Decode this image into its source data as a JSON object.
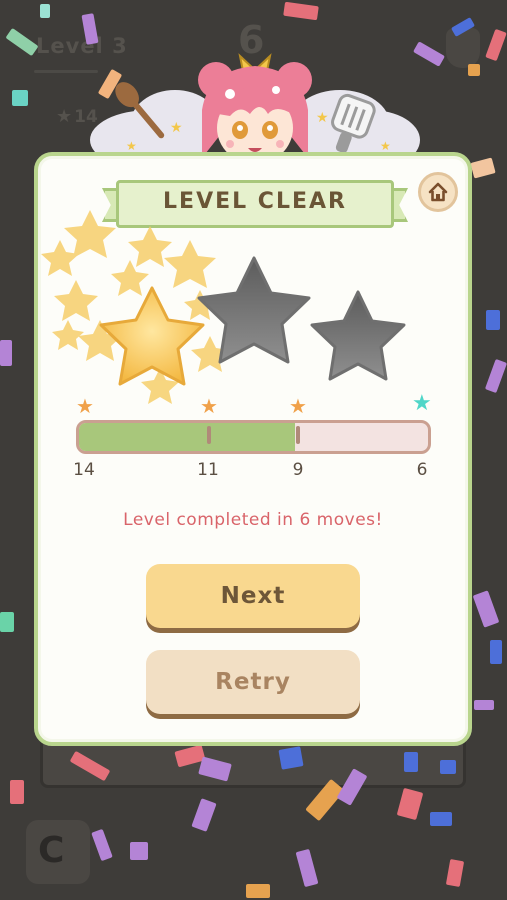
{
  "background": {
    "level_label": "Level 3",
    "moves_display": "6",
    "star_count": "14"
  },
  "popup": {
    "title": "LEVEL CLEAR",
    "stars_earned": 1,
    "stars_total": 3,
    "progress": {
      "fraction": 0.62,
      "markers": [
        "14",
        "11",
        "9",
        "6"
      ]
    },
    "message": "Level completed in 6 moves!",
    "next_label": "Next",
    "retry_label": "Retry"
  },
  "colors": {
    "panel_border": "#b9d58d",
    "progress_fill": "#a8c77b",
    "message": "#d9646a",
    "next_button": "#f9d88f",
    "retry_button": "#f2dfc4"
  },
  "icons": {
    "home": "home-icon",
    "earned_star": "star-gold-icon",
    "empty_star": "star-gray-icon"
  }
}
